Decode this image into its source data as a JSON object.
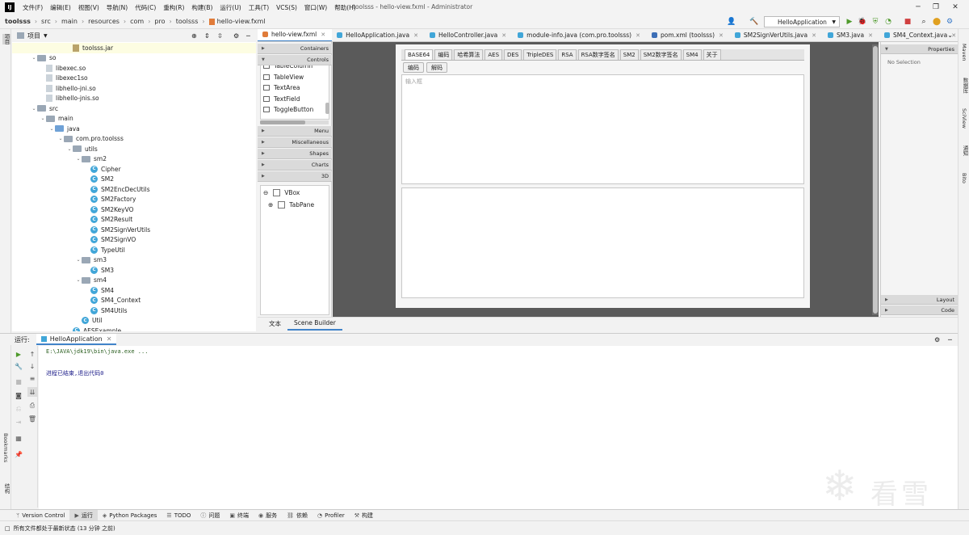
{
  "app": {
    "icon_letter": "IJ",
    "window_title": "toolsss - hello-view.fxml - Administrator",
    "menu": [
      "文件(F)",
      "编辑(E)",
      "视图(V)",
      "导航(N)",
      "代码(C)",
      "重构(R)",
      "构建(B)",
      "运行(U)",
      "工具(T)",
      "VCS(S)",
      "窗口(W)",
      "帮助(H)"
    ]
  },
  "breadcrumb": [
    "toolsss",
    "src",
    "main",
    "resources",
    "com",
    "pro",
    "toolsss",
    "hello-view.fxml"
  ],
  "run_config": "HelloApplication",
  "left_strip": {
    "project_label": "项目",
    "bookmarks_label": "Bookmarks",
    "structure_label": "结构"
  },
  "right_strip": {
    "maven_label": "Maven",
    "database_label": "数据库",
    "sciview_label": "SciView",
    "notifications_label": "通知",
    "bito_label": "Bito"
  },
  "project_panel": {
    "title": "项目",
    "nodes": [
      {
        "label": "toolsss.jar",
        "kind": "jar",
        "highlight": true
      },
      {
        "label": "so",
        "kind": "folder",
        "open": true
      },
      {
        "label": "libexec.so",
        "kind": "file"
      },
      {
        "label": "libexec1so",
        "kind": "file"
      },
      {
        "label": "libhello-jni.so",
        "kind": "file"
      },
      {
        "label": "libhello-jnis.so",
        "kind": "file"
      },
      {
        "label": "src",
        "kind": "folder",
        "open": true
      },
      {
        "label": "main",
        "kind": "folder",
        "open": true
      },
      {
        "label": "java",
        "kind": "src",
        "open": true
      },
      {
        "label": "com.pro.toolsss",
        "kind": "folder",
        "open": true
      },
      {
        "label": "utils",
        "kind": "folder",
        "open": true
      },
      {
        "label": "sm2",
        "kind": "folder",
        "open": true
      },
      {
        "label": "Cipher",
        "kind": "class"
      },
      {
        "label": "SM2",
        "kind": "class"
      },
      {
        "label": "SM2EncDecUtils",
        "kind": "class"
      },
      {
        "label": "SM2Factory",
        "kind": "class"
      },
      {
        "label": "SM2KeyVO",
        "kind": "class"
      },
      {
        "label": "SM2Result",
        "kind": "class"
      },
      {
        "label": "SM2SignVerUtils",
        "kind": "class"
      },
      {
        "label": "SM2SignVO",
        "kind": "class"
      },
      {
        "label": "TypeUtil",
        "kind": "class"
      },
      {
        "label": "sm3",
        "kind": "folder",
        "open": true
      },
      {
        "label": "SM3",
        "kind": "class"
      },
      {
        "label": "sm4",
        "kind": "folder",
        "open": true
      },
      {
        "label": "SM4",
        "kind": "class"
      },
      {
        "label": "SM4_Context",
        "kind": "class"
      },
      {
        "label": "SM4Utils",
        "kind": "class"
      },
      {
        "label": "Util",
        "kind": "class"
      },
      {
        "label": "AESExample",
        "kind": "class"
      }
    ]
  },
  "editor_tabs": [
    {
      "label": "hello-view.fxml",
      "active": true,
      "color": "#e07b39"
    },
    {
      "label": "HelloApplication.java",
      "active": false,
      "color": "#41a6d8"
    },
    {
      "label": "HelloController.java",
      "active": false,
      "color": "#41a6d8"
    },
    {
      "label": "module-info.java (com.pro.toolsss)",
      "active": false,
      "color": "#41a6d8"
    },
    {
      "label": "pom.xml (toolsss)",
      "active": false,
      "color": "#3d6fb6"
    },
    {
      "label": "SM2SignVerUtils.java",
      "active": false,
      "color": "#41a6d8"
    },
    {
      "label": "SM3.java",
      "active": false,
      "color": "#41a6d8"
    },
    {
      "label": "SM4_Context.java",
      "active": false,
      "color": "#41a6d8"
    }
  ],
  "scene_builder": {
    "library_sections_top": [
      "Containers",
      "Controls"
    ],
    "library_items": [
      "TableColumn",
      "TableView",
      "TextArea",
      "TextField",
      "ToggleButton"
    ],
    "library_sections_bottom": [
      "Menu",
      "Miscellaneous",
      "Shapes",
      "Charts",
      "3D"
    ],
    "hierarchy": [
      "VBox",
      "TabPane"
    ],
    "inspector": {
      "properties": "Properties",
      "no_selection": "No Selection",
      "layout": "Layout",
      "code": "Code"
    },
    "bottom_tabs": [
      {
        "label": "文本",
        "active": false
      },
      {
        "label": "Scene Builder",
        "active": true
      }
    ]
  },
  "fx_preview": {
    "tabs": [
      "BASE64",
      "编码",
      "哈希算法",
      "AES",
      "DES",
      "TripleDES",
      "RSA",
      "RSA数字签名",
      "SM2",
      "SM2数字签名",
      "SM4",
      "关于"
    ],
    "active_tab": "BASE64",
    "encode_button": "编码",
    "decode_button": "解码",
    "input_placeholder": "输入框"
  },
  "run_panel": {
    "title": "运行:",
    "tab_label": "HelloApplication",
    "command": "E:\\JAVA\\jdk19\\bin\\java.exe ...",
    "output": "进程已结束,退出代码0"
  },
  "bottom_bar": [
    {
      "label": "Version Control",
      "icon": "branch-icon",
      "active": false
    },
    {
      "label": "运行",
      "icon": "play-icon",
      "active": true
    },
    {
      "label": "Python Packages",
      "icon": "package-icon",
      "active": false
    },
    {
      "label": "TODO",
      "icon": "list-icon",
      "active": false
    },
    {
      "label": "问题",
      "icon": "info-icon",
      "active": false
    },
    {
      "label": "终端",
      "icon": "terminal-icon",
      "active": false
    },
    {
      "label": "服务",
      "icon": "services-icon",
      "active": false
    },
    {
      "label": "依赖",
      "icon": "dependencies-icon",
      "active": false
    },
    {
      "label": "Profiler",
      "icon": "profiler-icon",
      "active": false
    },
    {
      "label": "构建",
      "icon": "hammer-icon",
      "active": false
    }
  ],
  "status": "所有文件都处于最新状态 (13 分钟 之前)",
  "watermark": "看雪"
}
